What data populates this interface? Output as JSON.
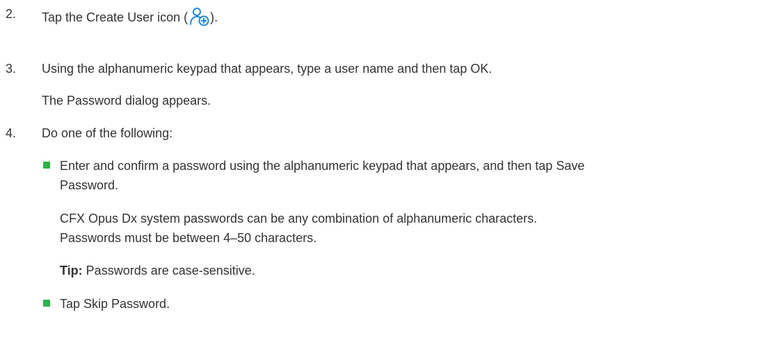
{
  "steps": [
    {
      "number": "2.",
      "text_before_icon": "Tap the Create User icon (",
      "icon": "create-user-icon",
      "text_after_icon": ")."
    },
    {
      "number": "3.",
      "text": "Using the alphanumeric keypad that appears, type a user name and then tap OK.",
      "result": "The Password dialog appears."
    },
    {
      "number": "4.",
      "text": "Do one of the following:",
      "options": [
        {
          "line1": "Enter and confirm a password using the alphanumeric keypad that appears, and then tap Save",
          "line2": "Password.",
          "note_line1": "CFX Opus Dx system passwords can be any combination of alphanumeric characters.",
          "note_line2": "Passwords must be between 4–50 characters.",
          "tip_label": "Tip:",
          "tip_text": " Passwords are case-sensitive."
        },
        {
          "text": "Tap Skip Password."
        }
      ]
    }
  ],
  "colors": {
    "text": "#333333",
    "bullet": "#2db24a",
    "icon": "#1e88e5"
  }
}
